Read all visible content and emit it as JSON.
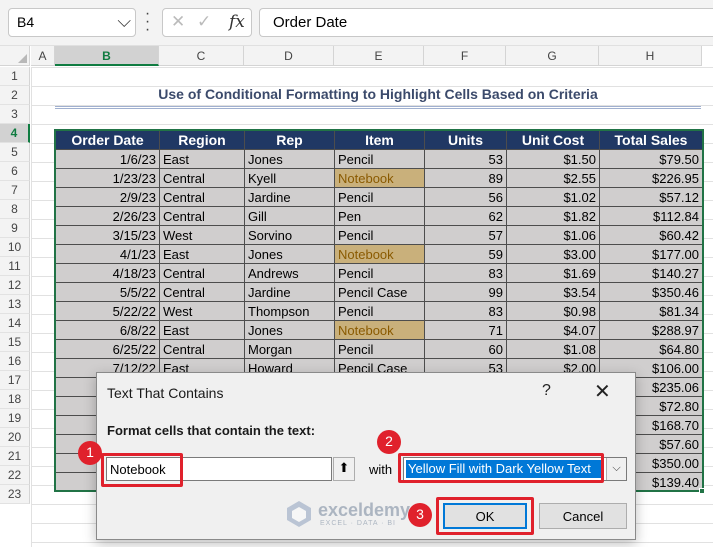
{
  "formula_bar": {
    "name_box": "B4",
    "formula": "Order Date",
    "fx_label": "fx",
    "cancel_icon": "x-icon",
    "enter_icon": "checkmark-icon"
  },
  "columns": [
    "A",
    "B",
    "C",
    "D",
    "E",
    "F",
    "G",
    "H"
  ],
  "rows": [
    "1",
    "2",
    "3",
    "4",
    "5",
    "6",
    "7",
    "8",
    "9",
    "10",
    "11",
    "12",
    "13",
    "14",
    "15",
    "16",
    "17",
    "18",
    "19",
    "20",
    "21",
    "22",
    "23"
  ],
  "sheet": {
    "title": "Use of Conditional Formatting to Highlight Cells Based on Criteria",
    "headers": [
      "Order Date",
      "Region",
      "Rep",
      "Item",
      "Units",
      "Unit Cost",
      "Total Sales"
    ],
    "highlight_color": "#c9b07b",
    "header_color": "#203864",
    "rows": [
      [
        "1/6/23",
        "East",
        "Jones",
        "Pencil",
        "53",
        "$1.50",
        "$79.50"
      ],
      [
        "1/23/23",
        "Central",
        "Kyell",
        "Notebook",
        "89",
        "$2.55",
        "$226.95"
      ],
      [
        "2/9/23",
        "Central",
        "Jardine",
        "Pencil",
        "56",
        "$1.02",
        "$57.12"
      ],
      [
        "2/26/23",
        "Central",
        "Gill",
        "Pen",
        "62",
        "$1.82",
        "$112.84"
      ],
      [
        "3/15/23",
        "West",
        "Sorvino",
        "Pencil",
        "57",
        "$1.06",
        "$60.42"
      ],
      [
        "4/1/23",
        "East",
        "Jones",
        "Notebook",
        "59",
        "$3.00",
        "$177.00"
      ],
      [
        "4/18/23",
        "Central",
        "Andrews",
        "Pencil",
        "83",
        "$1.69",
        "$140.27"
      ],
      [
        "5/5/22",
        "Central",
        "Jardine",
        "Pencil Case",
        "99",
        "$3.54",
        "$350.46"
      ],
      [
        "5/22/22",
        "West",
        "Thompson",
        "Pencil",
        "83",
        "$0.98",
        "$81.34"
      ],
      [
        "6/8/22",
        "East",
        "Jones",
        "Notebook",
        "71",
        "$4.07",
        "$288.97"
      ],
      [
        "6/25/22",
        "Central",
        "Morgan",
        "Pencil",
        "60",
        "$1.08",
        "$64.80"
      ],
      [
        "7/12/22",
        "East",
        "Howard",
        "Pencil Case",
        "53",
        "$2.00",
        "$106.00"
      ],
      [
        "",
        "",
        "",
        "",
        "",
        "",
        "$235.06"
      ],
      [
        "",
        "",
        "",
        "",
        "",
        "",
        "$72.80"
      ],
      [
        "",
        "",
        "",
        "",
        "",
        "",
        "$168.70"
      ],
      [
        "",
        "",
        "",
        "",
        "",
        "",
        "$57.60"
      ],
      [
        "",
        "",
        "",
        "",
        "",
        "",
        "$350.00"
      ],
      [
        "",
        "",
        "",
        "",
        "",
        "",
        "$139.40"
      ]
    ]
  },
  "dialog": {
    "title": "Text That Contains",
    "help": "?",
    "close": "✕",
    "label": "Format cells that contain the text:",
    "text_value": "Notebook",
    "collapse_glyph": "⬆",
    "with_label": "with",
    "format_value": "Yellow Fill with Dark Yellow Text",
    "dropdown_glyph": "⌵",
    "ok_label": "OK",
    "cancel_label": "Cancel"
  },
  "watermark": {
    "name": "exceldemy",
    "sub": "EXCEL · DATA · BI"
  },
  "callouts": [
    "1",
    "2",
    "3"
  ]
}
